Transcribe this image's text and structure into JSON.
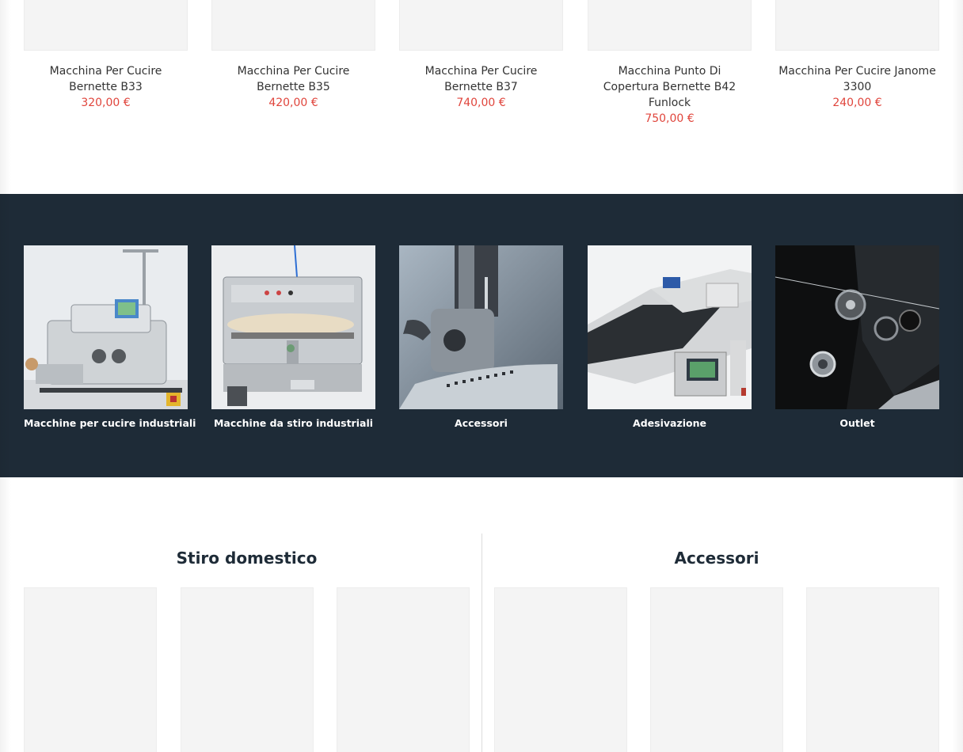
{
  "products": [
    {
      "name": "Macchina Per Cucire Bernette B33",
      "price": "320,00 €"
    },
    {
      "name": "Macchina Per Cucire Bernette B35",
      "price": "420,00 €"
    },
    {
      "name": "Macchina Per Cucire Bernette B37",
      "price": "740,00 €"
    },
    {
      "name": "Macchina Punto Di Copertura Bernette B42 Funlock",
      "price": "750,00 €"
    },
    {
      "name": "Macchina Per Cucire Janome 3300",
      "price": "240,00 €"
    }
  ],
  "categories": [
    {
      "label": "Macchine per cucire industriali"
    },
    {
      "label": "Macchine da stiro industriali"
    },
    {
      "label": "Accessori"
    },
    {
      "label": "Adesivazione"
    },
    {
      "label": "Outlet"
    }
  ],
  "sections": {
    "left_title": "Stiro domestico",
    "right_title": "Accessori"
  },
  "colors": {
    "price": "#e0453c",
    "band_bg": "#1e2b37",
    "title": "#1e2b37"
  }
}
